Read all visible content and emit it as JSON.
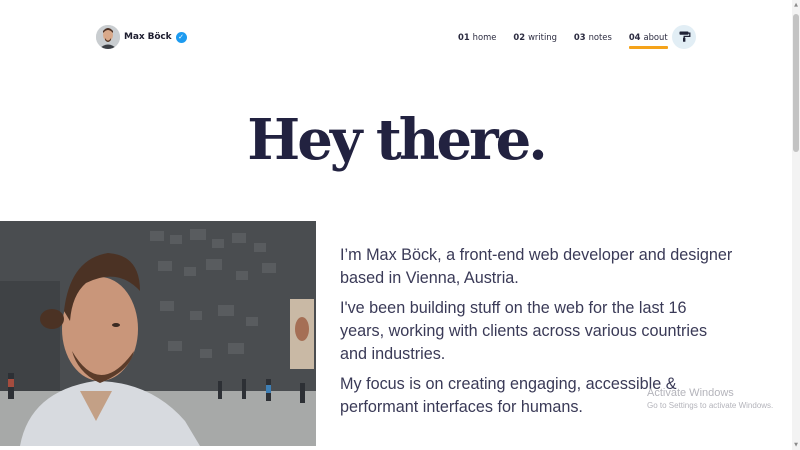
{
  "brand": {
    "name": "Max Böck",
    "verified_icon": "verified-check-icon",
    "badge_color": "#1d9bf0"
  },
  "nav": {
    "items": [
      {
        "num": "01",
        "label": "home"
      },
      {
        "num": "02",
        "label": "writing"
      },
      {
        "num": "03",
        "label": "notes"
      },
      {
        "num": "04",
        "label": "about",
        "active": true
      }
    ],
    "active_underline_color": "#f5a31a"
  },
  "theme_toggle": {
    "icon": "paint-roller-icon"
  },
  "hero": {
    "title": "Hey there."
  },
  "photo": {
    "subject": "portrait-photo"
  },
  "intro": {
    "p1": "I’m Max Böck, a front-end web developer and designer based in Vienna, Austria.",
    "p2": "I've been building stuff on the web for the last 16 years, working with clients across various countries and industries.",
    "p3": "My focus is on creating engaging, accessible & performant interfaces for humans."
  },
  "watermark": {
    "line1": "Activate Windows",
    "line2": "Go to Settings to activate Windows."
  }
}
